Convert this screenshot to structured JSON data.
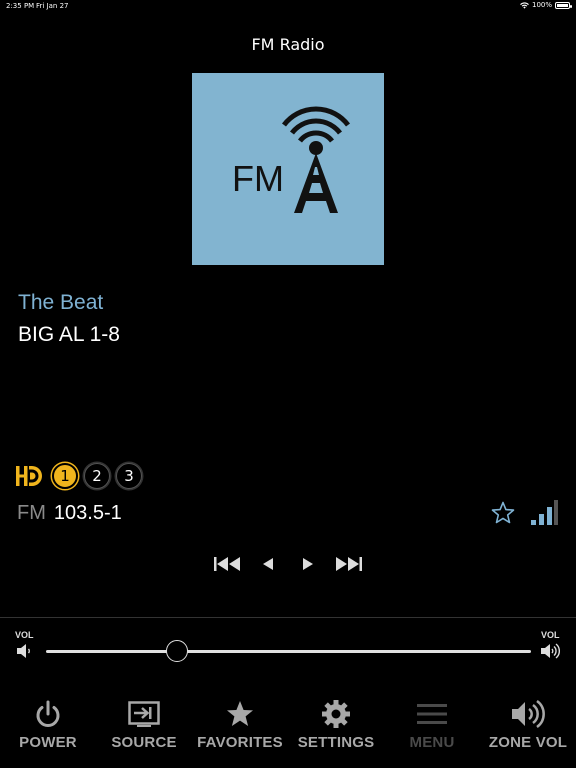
{
  "status_bar": {
    "time": "2:35 PM",
    "date": "Fri Jan 27",
    "battery": "100%"
  },
  "header": {
    "title": "FM Radio"
  },
  "album_art": {
    "text": "FM",
    "background": "#82b4d0",
    "icon": "radio-tower-icon"
  },
  "now_playing": {
    "station": "The Beat",
    "song": "BIG AL 1-8"
  },
  "hd": {
    "logo": "hd-radio-icon",
    "channels": [
      {
        "label": "1",
        "active": true
      },
      {
        "label": "2",
        "active": false
      },
      {
        "label": "3",
        "active": false
      }
    ]
  },
  "tuner": {
    "band": "FM",
    "frequency": "103.5-1"
  },
  "transport": [
    "skip-back-icon",
    "prev-icon",
    "next-icon",
    "skip-forward-icon"
  ],
  "volume": {
    "label_left": "VOL",
    "label_right": "VOL",
    "level": 0.27
  },
  "nav": [
    {
      "label": "POWER",
      "icon": "power-icon"
    },
    {
      "label": "SOURCE",
      "icon": "source-icon"
    },
    {
      "label": "FAVORITES",
      "icon": "star-icon"
    },
    {
      "label": "SETTINGS",
      "icon": "gear-icon"
    },
    {
      "label": "MENU",
      "icon": "menu-icon",
      "disabled": true
    },
    {
      "label": "ZONE VOL",
      "icon": "zone-volume-icon"
    }
  ],
  "colors": {
    "accent_blue": "#7fb2d3",
    "hd_yellow": "#f0b51d",
    "nav_gray": "#a8a8a8"
  }
}
